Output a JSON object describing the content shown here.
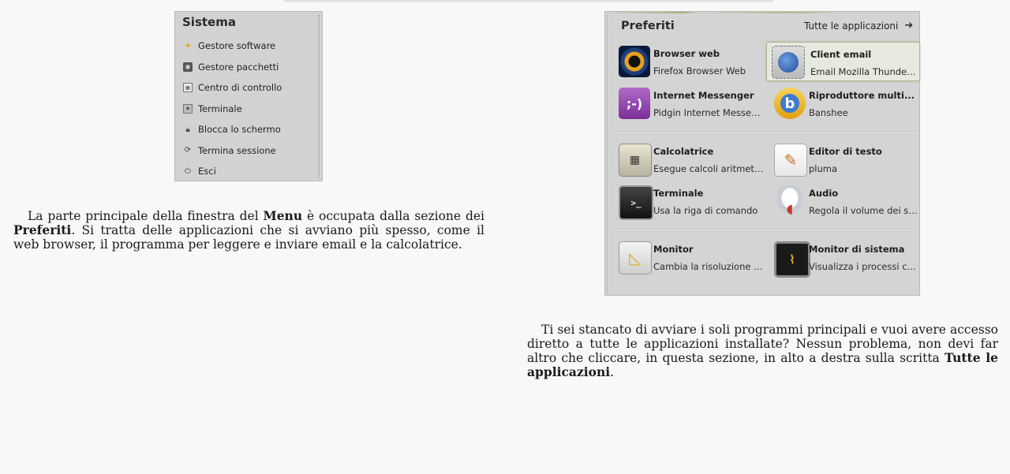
{
  "system_menu": {
    "title": "Sistema",
    "items": [
      {
        "label": "Gestore software",
        "icon": "software-manager-icon"
      },
      {
        "label": "Gestore pacchetti",
        "icon": "package-manager-icon"
      },
      {
        "label": "Centro di controllo",
        "icon": "control-center-icon"
      },
      {
        "label": "Terminale",
        "icon": "terminal-icon"
      },
      {
        "label": "Blocca lo schermo",
        "icon": "lock-icon"
      },
      {
        "label": "Termina sessione",
        "icon": "logout-icon"
      },
      {
        "label": "Esci",
        "icon": "power-icon"
      }
    ]
  },
  "paragraph1": {
    "t1": "La parte principale della finestra del ",
    "b1": "Menu",
    "t2": " è occupata dalla sezione dei ",
    "b2": "Preferiti",
    "t3": ". Si tratta delle applicazioni che si avviano più spesso, come il web browser, il programma per leggere e inviare email e la calcolatrice."
  },
  "favorites": {
    "title": "Preferiti",
    "all_apps_label": "Tutte le applicazioni",
    "apps": [
      {
        "name": "Browser web",
        "desc": "Firefox Browser Web",
        "icon": "firefox-icon",
        "glyph": ""
      },
      {
        "name": "Client email",
        "desc": "Email Mozilla Thunderb...",
        "icon": "thunderbird-icon",
        "glyph": ""
      },
      {
        "name": "Internet Messenger",
        "desc": "Pidgin Internet Messen...",
        "icon": "pidgin-icon",
        "glyph": ";-)"
      },
      {
        "name": "Riproduttore multi...",
        "desc": "Banshee",
        "icon": "banshee-icon",
        "glyph": "b"
      },
      {
        "name": "Calcolatrice",
        "desc": "Esegue calcoli aritmeti...",
        "icon": "calculator-icon",
        "glyph": "▦"
      },
      {
        "name": "Editor di testo",
        "desc": "pluma",
        "icon": "text-editor-icon",
        "glyph": "✎"
      },
      {
        "name": "Terminale",
        "desc": "Usa la riga di comando",
        "icon": "terminal-icon",
        "glyph": ">_"
      },
      {
        "name": "Audio",
        "desc": "Regola il volume dei su...",
        "icon": "audio-icon",
        "glyph": "◖"
      },
      {
        "name": "Monitor",
        "desc": "Cambia la risoluzione e...",
        "icon": "monitor-icon",
        "glyph": "◺"
      },
      {
        "name": "Monitor di sistema",
        "desc": "Visualizza i processi cor...",
        "icon": "system-monitor-icon",
        "glyph": "⌇"
      }
    ]
  },
  "paragraph2": {
    "t1": "Ti sei stancato di avviare i soli programmi principali e vuoi avere accesso diretto a tutte le applicazioni installate? Nessun problema, non devi far altro che cliccare, in questa sezione, in alto a destra sulla scritta ",
    "b1": "Tutte le applicazioni",
    "t2": "."
  },
  "colors": {
    "page_bg": "#f8f8f8",
    "panel_bg": "#d4d4d4",
    "selected_border": "#a9b88a"
  }
}
